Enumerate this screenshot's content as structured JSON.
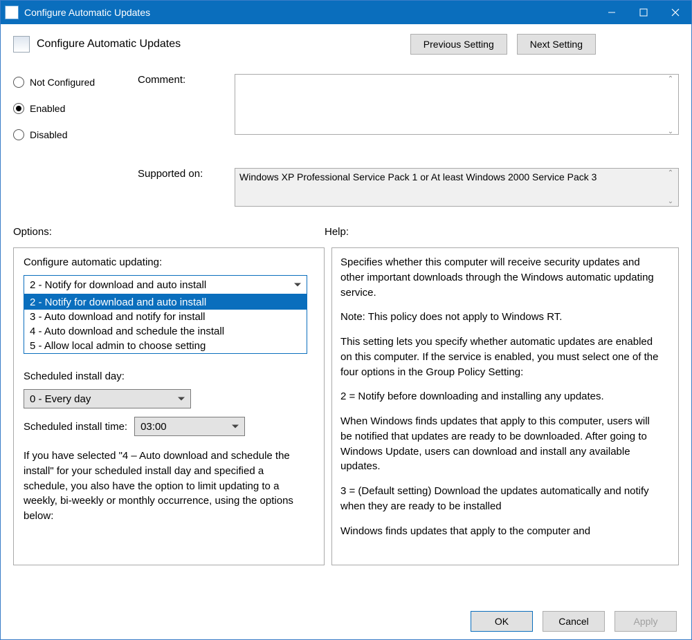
{
  "window": {
    "title": "Configure Automatic Updates"
  },
  "header": {
    "policy_title": "Configure Automatic Updates",
    "previous_btn": "Previous Setting",
    "next_btn": "Next Setting"
  },
  "state": {
    "options": [
      "Not Configured",
      "Enabled",
      "Disabled"
    ],
    "selected": "Enabled"
  },
  "labels": {
    "comment": "Comment:",
    "supported_on": "Supported on:",
    "options_header": "Options:",
    "help_header": "Help:"
  },
  "comment_value": "",
  "supported_text": "Windows XP Professional Service Pack 1 or At least Windows 2000 Service Pack 3",
  "options": {
    "configure_label": "Configure automatic updating:",
    "dropdown_selected": "2 - Notify for download and auto install",
    "dropdown_items": [
      "2 - Notify for download and auto install",
      "3 - Auto download and notify for install",
      "4 - Auto download and schedule the install",
      "5 - Allow local admin to choose setting"
    ],
    "day_label": "Scheduled install day:",
    "day_value": "0 - Every day",
    "time_label": "Scheduled install time:",
    "time_value": "03:00",
    "note": "If you have selected \"4 – Auto download and schedule the install\" for your scheduled install day and specified a schedule, you also have the option to limit updating to a weekly, bi-weekly or monthly occurrence, using the options below:"
  },
  "help": {
    "p1": "Specifies whether this computer will receive security updates and other important downloads through the Windows automatic updating service.",
    "p2": "Note: This policy does not apply to Windows RT.",
    "p3": "This setting lets you specify whether automatic updates are enabled on this computer. If the service is enabled, you must select one of the four options in the Group Policy Setting:",
    "opt2": "2 = Notify before downloading and installing any updates.",
    "opt2desc": "When Windows finds updates that apply to this computer, users will be notified that updates are ready to be downloaded. After going to Windows Update, users can download and install any available updates.",
    "opt3": "3 = (Default setting) Download the updates automatically and notify when they are ready to be installed",
    "opt3desc": "Windows finds updates that apply to the computer and"
  },
  "footer": {
    "ok": "OK",
    "cancel": "Cancel",
    "apply": "Apply"
  }
}
